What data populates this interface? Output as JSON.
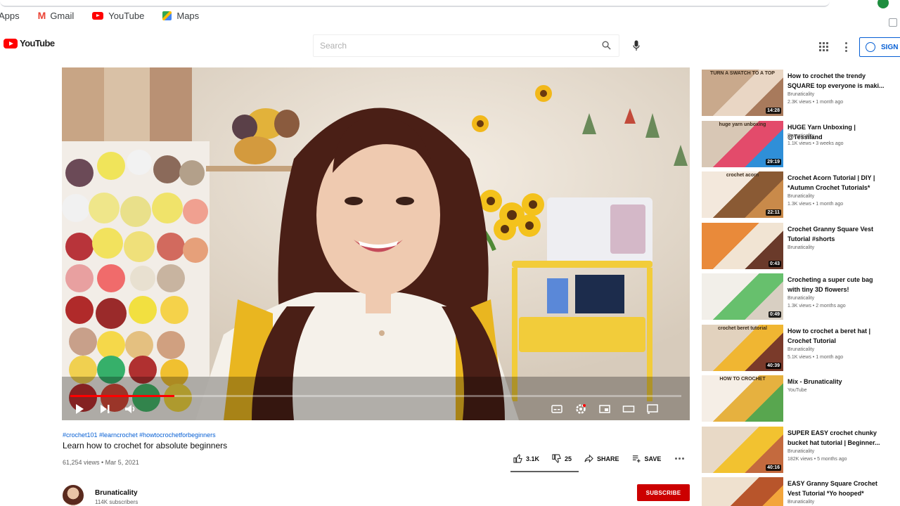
{
  "bookmarks": {
    "apps_label": "Apps",
    "items": [
      {
        "label": "Gmail",
        "icon": "gmail-icon"
      },
      {
        "label": "YouTube",
        "icon": "youtube-icon"
      },
      {
        "label": "Maps",
        "icon": "maps-icon"
      }
    ]
  },
  "masthead": {
    "logo_text": "YouTube",
    "search_placeholder": "Search",
    "signin_label": "SIGN IN"
  },
  "player": {
    "progress_fraction": 0.17
  },
  "video": {
    "hashtags": "#crochet101 #learncrochet #howtocrochetforbeginners",
    "title": "Learn how to crochet for absolute beginners",
    "views_date": "61,254 views • Mar 5, 2021",
    "likes": "3.1K",
    "dislikes": "25",
    "share_label": "SHARE",
    "save_label": "SAVE"
  },
  "channel": {
    "name": "Brunaticality",
    "subscribers": "114K subscribers",
    "subscribe_label": "SUBSCRIBE"
  },
  "recommendations": [
    {
      "title": "How to crochet the trendy SQUARE top everyone is maki...",
      "channel": "Brunaticality",
      "meta": "2.3K views • 1 month ago",
      "duration": "14:28",
      "thumb_text": "TURN A SWATCH TO A TOP",
      "colors": [
        "#c9a98c",
        "#e9d6c4",
        "#a87a5c"
      ]
    },
    {
      "title": "HUGE Yarn Unboxing | @Tessiland",
      "channel": "Brunaticality",
      "meta": "1.1K views • 3 weeks ago",
      "duration": "29:19",
      "thumb_text": "huge yarn unboxing",
      "colors": [
        "#d8c7b5",
        "#e34b6b",
        "#2f8fd8"
      ]
    },
    {
      "title": "Crochet Acorn Tutorial | DIY | *Autumn Crochet Tutorials*",
      "channel": "Brunaticality",
      "meta": "1.3K views • 1 month ago",
      "duration": "22:11",
      "thumb_text": "crochet acorn",
      "colors": [
        "#f3e8dc",
        "#8a5a34",
        "#c98a4a"
      ]
    },
    {
      "title": "Crochet Granny Square Vest Tutorial #shorts",
      "channel": "Brunaticality",
      "meta": "",
      "duration": "0:43",
      "thumb_text": "",
      "colors": [
        "#e98a3a",
        "#f1e4d3",
        "#6a3a2a"
      ]
    },
    {
      "title": "Crocheting a super cute bag with tiny 3D flowers!",
      "channel": "Brunaticality",
      "meta": "1.3K views • 2 months ago",
      "duration": "0:49",
      "thumb_text": "",
      "colors": [
        "#f2efe9",
        "#67c06d",
        "#d8cfc2"
      ]
    },
    {
      "title": "How to crochet a beret hat | Crochet Tutorial",
      "channel": "Brunaticality",
      "meta": "5.1K views • 1 month ago",
      "duration": "40:39",
      "thumb_text": "crochet beret tutorial",
      "colors": [
        "#e2d2be",
        "#f0b632",
        "#7a3a2a"
      ]
    },
    {
      "title": "Mix - Brunaticality",
      "channel": "YouTube",
      "meta": "",
      "duration": "",
      "thumb_text": "HOW TO CROCHET",
      "colors": [
        "#f5eee6",
        "#e6b13f",
        "#58a64f"
      ]
    },
    {
      "title": "SUPER EASY crochet chunky bucket hat tutorial | Beginner...",
      "channel": "Brunaticality",
      "meta": "182K views • 5 months ago",
      "duration": "40:16",
      "thumb_text": "",
      "colors": [
        "#e8d9c6",
        "#f2c230",
        "#c46a3e"
      ]
    },
    {
      "title": "EASY Granny Square Crochet Vest Tutorial *Yo hooped*",
      "channel": "Brunaticality",
      "meta": "",
      "duration": "",
      "thumb_text": "",
      "colors": [
        "#efe1cf",
        "#b8552b",
        "#f3a53b"
      ]
    }
  ]
}
